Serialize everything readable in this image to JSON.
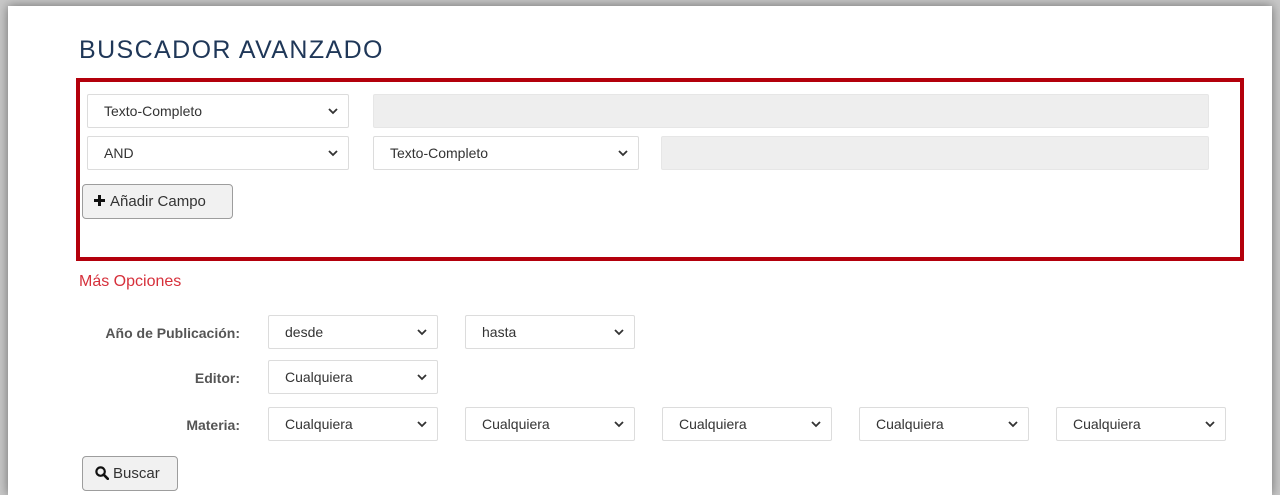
{
  "title": "BUSCADOR AVANZADO",
  "colors": {
    "accent": "#b3000c",
    "title": "#1f3758",
    "more_options": "#d6303b"
  },
  "search": {
    "row1": {
      "field": "Texto-Completo",
      "value": ""
    },
    "row2": {
      "operator": "AND",
      "field": "Texto-Completo",
      "value": ""
    },
    "add_field_button": {
      "label": "Añadir Campo",
      "icon": "plus-icon"
    }
  },
  "more_options": {
    "heading": "Más Opciones",
    "year": {
      "label": "Año de Publicación:",
      "from": "desde",
      "to": "hasta"
    },
    "publisher": {
      "label": "Editor:",
      "value": "Cualquiera"
    },
    "subject": {
      "label": "Materia:",
      "values": [
        "Cualquiera",
        "Cualquiera",
        "Cualquiera",
        "Cualquiera",
        "Cualquiera"
      ]
    }
  },
  "search_button": {
    "label": "Buscar",
    "icon": "search-icon"
  }
}
